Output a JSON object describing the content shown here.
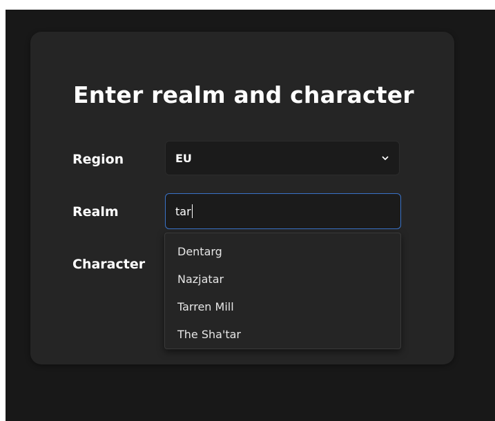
{
  "form": {
    "title": "Enter realm and character",
    "region_label": "Region",
    "realm_label": "Realm",
    "character_label": "Character",
    "region_value": "EU",
    "realm_value": "tar"
  },
  "suggestions": [
    "Dentarg",
    "Nazjatar",
    "Tarren Mill",
    "The Sha'tar"
  ],
  "colors": {
    "page_bg": "#181818",
    "card_bg": "#252525",
    "focus_border": "#3a73c9"
  },
  "icons": {
    "select_arrow": "chevron-down-icon"
  }
}
